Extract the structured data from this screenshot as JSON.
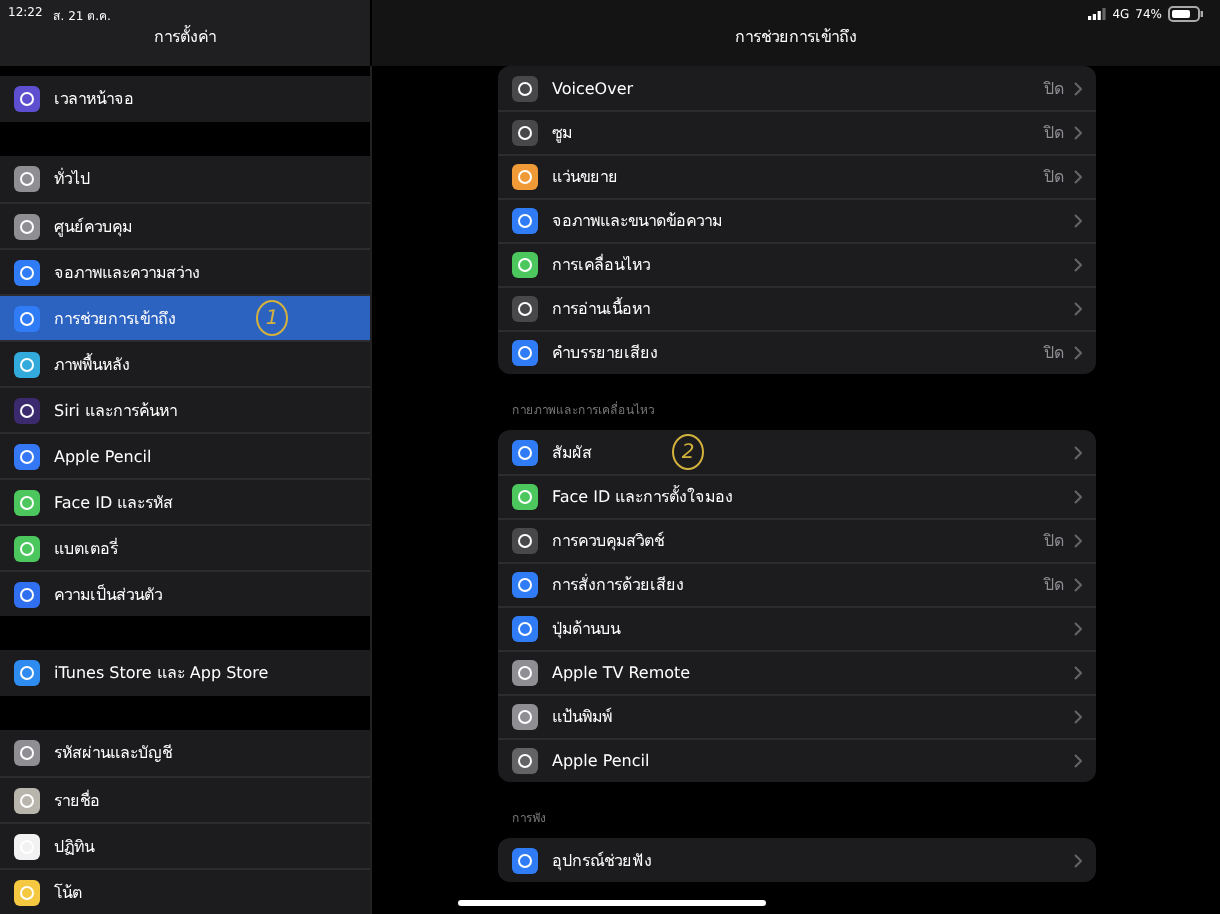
{
  "status_bar": {
    "time": "12:22",
    "date": "ส. 21 ต.ค.",
    "network": "4G",
    "battery": "74%"
  },
  "sidebar": {
    "title": "การตั้งค่า",
    "groups": [
      [
        {
          "label": "เวลาหน้าจอ",
          "color": "#5e4fd1",
          "selected": false
        }
      ],
      [
        {
          "label": "ทั่วไป",
          "color": "#8e8e93",
          "selected": false
        },
        {
          "label": "ศูนย์ควบคุม",
          "color": "#8e8e93",
          "selected": false
        },
        {
          "label": "จอภาพและความสว่าง",
          "color": "#2f7cf6",
          "selected": false
        },
        {
          "label": "การช่วยการเข้าถึง",
          "color": "#2f7cf6",
          "selected": true,
          "annotation": "1"
        },
        {
          "label": "ภาพพื้นหลัง",
          "color": "#33aadc",
          "selected": false
        },
        {
          "label": "Siri และการค้นหา",
          "color": "#3b2b6e",
          "selected": false
        },
        {
          "label": "Apple Pencil",
          "color": "#3478f6",
          "selected": false
        },
        {
          "label": "Face ID และรหัส",
          "color": "#4cc75e",
          "selected": false
        },
        {
          "label": "แบตเตอรี่",
          "color": "#4cc75e",
          "selected": false
        },
        {
          "label": "ความเป็นส่วนตัว",
          "color": "#2f6ff0",
          "selected": false
        }
      ],
      [
        {
          "label": "iTunes Store และ App Store",
          "color": "#2e8cf0",
          "selected": false
        }
      ],
      [
        {
          "label": "รหัสผ่านและบัญชี",
          "color": "#8e8e93",
          "selected": false
        },
        {
          "label": "รายชื่อ",
          "color": "#b8b5ad",
          "selected": false
        },
        {
          "label": "ปฏิทิน",
          "color": "#f2f2f2",
          "selected": false
        },
        {
          "label": "โน้ต",
          "color": "#f5c842",
          "selected": false
        }
      ]
    ]
  },
  "main": {
    "title": "การช่วยการเข้าถึง",
    "sections": [
      {
        "rows": [
          {
            "label": "VoiceOver",
            "value": "ปิด",
            "color": "#48484a"
          },
          {
            "label": "ซูม",
            "value": "ปิด",
            "color": "#48484a"
          },
          {
            "label": "แว่นขยาย",
            "value": "ปิด",
            "color": "#f09a37"
          },
          {
            "label": "จอภาพและขนาดข้อความ",
            "color": "#2f7cf6"
          },
          {
            "label": "การเคลื่อนไหว",
            "color": "#4cc75e"
          },
          {
            "label": "การอ่านเนื้อหา",
            "color": "#48484a"
          },
          {
            "label": "คำบรรยายเสียง",
            "value": "ปิด",
            "color": "#2f7cf6"
          }
        ]
      },
      {
        "header": "กายภาพและการเคลื่อนไหว",
        "rows": [
          {
            "label": "สัมผัส",
            "color": "#2f7cf6",
            "annotation": "2"
          },
          {
            "label": "Face ID และการตั้งใจมอง",
            "color": "#4cc75e"
          },
          {
            "label": "การควบคุมสวิตช์",
            "value": "ปิด",
            "color": "#48484a"
          },
          {
            "label": "การสั่งการด้วยเสียง",
            "value": "ปิด",
            "color": "#2f7cf6"
          },
          {
            "label": "ปุ่มด้านบน",
            "color": "#2f7cf6"
          },
          {
            "label": "Apple TV Remote",
            "color": "#8e8e93"
          },
          {
            "label": "แป้นพิมพ์",
            "color": "#8e8e93"
          },
          {
            "label": "Apple Pencil",
            "color": "#636366"
          }
        ]
      },
      {
        "header": "การฟัง",
        "rows": [
          {
            "label": "อุปกรณ์ช่วยฟัง",
            "color": "#2f7cf6"
          }
        ]
      }
    ]
  }
}
